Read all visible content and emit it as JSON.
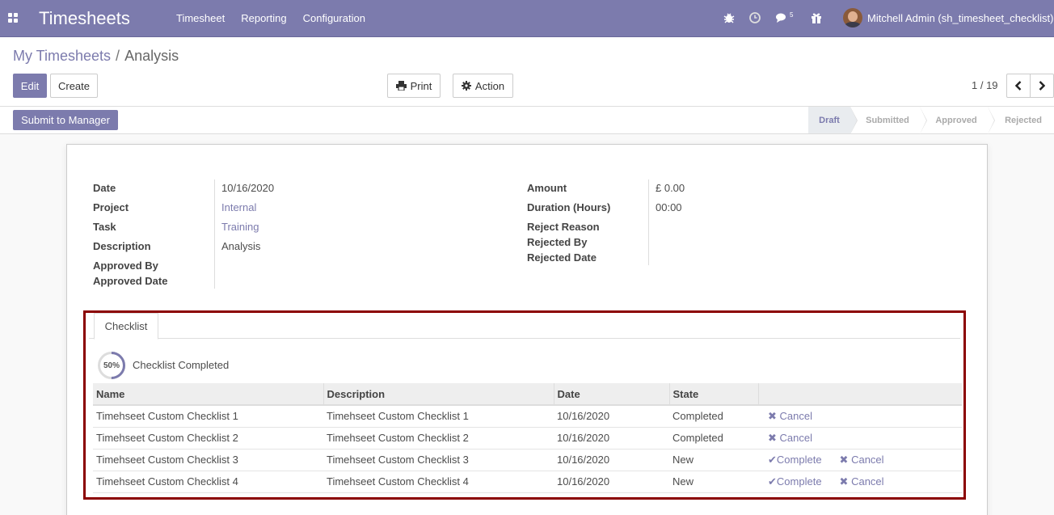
{
  "navbar": {
    "app_title": "Timesheets",
    "menu": [
      "Timesheet",
      "Reporting",
      "Configuration"
    ],
    "messages_count": "5",
    "user_name": "Mitchell Admin (sh_timesheet_checklist)",
    "bg_color": "#7c7bad"
  },
  "breadcrumb": {
    "parent": "My Timesheets",
    "separator": "/",
    "current": "Analysis"
  },
  "buttons": {
    "edit": "Edit",
    "create": "Create",
    "print": "Print",
    "action": "Action"
  },
  "pager": {
    "value": "1 / 19"
  },
  "statusbar": {
    "submit_label": "Submit to Manager",
    "stages": [
      "Draft",
      "Submitted",
      "Approved",
      "Rejected"
    ],
    "active_stage": "Draft"
  },
  "form": {
    "left": [
      {
        "label": "Date",
        "value": "10/16/2020",
        "link": false
      },
      {
        "label": "Project",
        "value": "Internal",
        "link": true
      },
      {
        "label": "Task",
        "value": "Training",
        "link": true
      },
      {
        "label": "Description",
        "value": "Analysis",
        "link": false
      },
      {
        "label": "Approved By",
        "value": "",
        "link": false
      },
      {
        "label": "Approved Date",
        "value": "",
        "link": false
      }
    ],
    "right": [
      {
        "label": "Amount",
        "value": "£ 0.00"
      },
      {
        "label": "Duration (Hours)",
        "value": "00:00"
      },
      {
        "label": "Reject Reason",
        "value": ""
      },
      {
        "label": "Rejected By",
        "value": ""
      },
      {
        "label": "Rejected Date",
        "value": ""
      }
    ]
  },
  "checklist": {
    "tab_label": "Checklist",
    "progress": "50%",
    "progress_fraction": 0.5,
    "progress_label": "Checklist Completed",
    "columns": [
      "Name",
      "Description",
      "Date",
      "State",
      ""
    ],
    "complete_label": "Complete",
    "cancel_label": "Cancel",
    "rows": [
      {
        "name": "Timehseet Custom Checklist 1",
        "description": "Timehseet Custom Checklist 1",
        "date": "10/16/2020",
        "state": "Completed"
      },
      {
        "name": "Timehseet Custom Checklist 2",
        "description": "Timehseet Custom Checklist 2",
        "date": "10/16/2020",
        "state": "Completed"
      },
      {
        "name": "Timehseet Custom Checklist 3",
        "description": "Timehseet Custom Checklist 3",
        "date": "10/16/2020",
        "state": "New"
      },
      {
        "name": "Timehseet Custom Checklist 4",
        "description": "Timehseet Custom Checklist 4",
        "date": "10/16/2020",
        "state": "New"
      }
    ]
  }
}
